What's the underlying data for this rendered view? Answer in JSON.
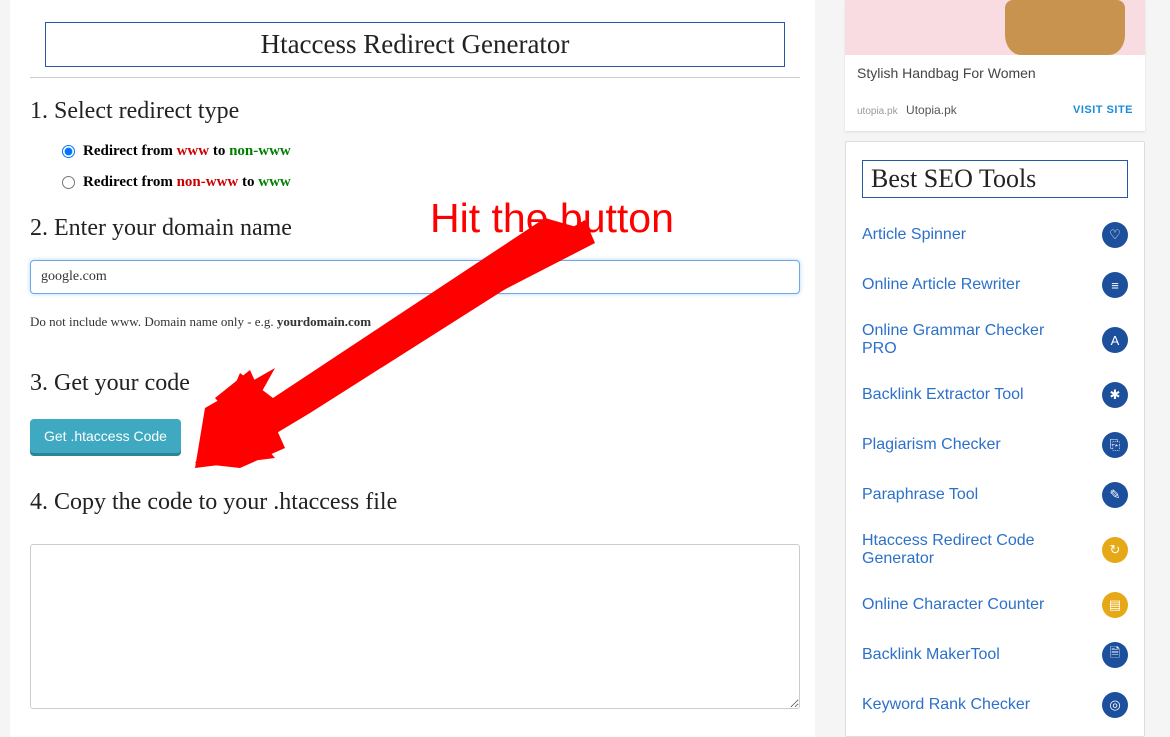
{
  "title": "Htaccess Redirect Generator",
  "section1": {
    "heading": "1. Select redirect type",
    "option1": {
      "prefix": "Redirect from ",
      "from": "www",
      "mid": " to ",
      "to": "non-www"
    },
    "option2": {
      "prefix": "Redirect from ",
      "from": "non-www",
      "mid": " to ",
      "to": "www"
    }
  },
  "section2": {
    "heading": "2. Enter your domain name",
    "domain_value": "google.com",
    "helper_prefix": "Do not include www. Domain name only - e.g. ",
    "helper_bold": "yourdomain.com"
  },
  "section3": {
    "heading": "3. Get your code",
    "button_label": "Get .htaccess Code"
  },
  "section4": {
    "heading": "4. Copy the code to your .htaccess file"
  },
  "annotation_text": "Hit the button",
  "ad": {
    "text": "Stylish Handbag For Women",
    "brand_logo": "utopia.pk",
    "brand": "Utopia.pk",
    "visit": "VISIT SITE"
  },
  "tools": {
    "title": "Best SEO Tools",
    "items": [
      {
        "label": "Article Spinner",
        "icon": "spinner-icon"
      },
      {
        "label": "Online Article Rewriter",
        "icon": "rewriter-icon"
      },
      {
        "label": "Online Grammar Checker PRO",
        "icon": "grammar-icon"
      },
      {
        "label": "Backlink Extractor Tool",
        "icon": "backlink-icon"
      },
      {
        "label": "Plagiarism Checker",
        "icon": "plagiarism-icon"
      },
      {
        "label": "Paraphrase Tool",
        "icon": "paraphrase-icon"
      },
      {
        "label": "Htaccess Redirect Code Generator",
        "icon": "htaccess-icon"
      },
      {
        "label": "Online Character Counter",
        "icon": "counter-icon"
      },
      {
        "label": "Backlink MakerTool",
        "icon": "maker-icon"
      },
      {
        "label": "Keyword Rank Checker",
        "icon": "rank-icon"
      }
    ]
  }
}
